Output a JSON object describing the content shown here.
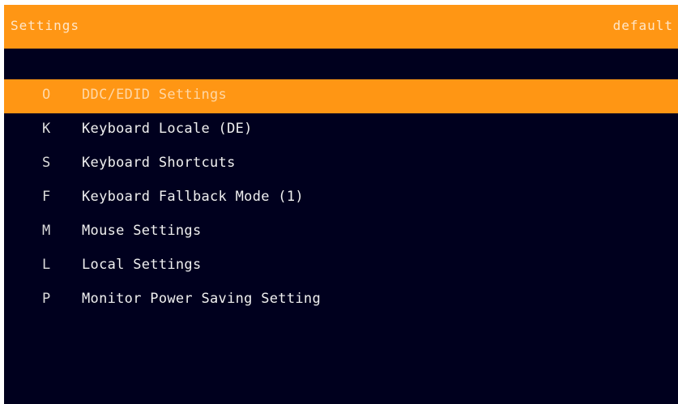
{
  "header": {
    "title": "Settings",
    "profile": "default"
  },
  "colors": {
    "accent": "#ff9614",
    "background": "#00001e",
    "text": "#f0f0f0"
  },
  "menu": {
    "selected_index": 0,
    "items": [
      {
        "key": "O",
        "label": "DDC/EDID Settings"
      },
      {
        "key": "K",
        "label": "Keyboard Locale (DE)"
      },
      {
        "key": "S",
        "label": "Keyboard Shortcuts"
      },
      {
        "key": "F",
        "label": "Keyboard Fallback Mode (1)"
      },
      {
        "key": "M",
        "label": "Mouse Settings"
      },
      {
        "key": "L",
        "label": "Local Settings"
      },
      {
        "key": "P",
        "label": "Monitor Power Saving Setting"
      }
    ]
  }
}
